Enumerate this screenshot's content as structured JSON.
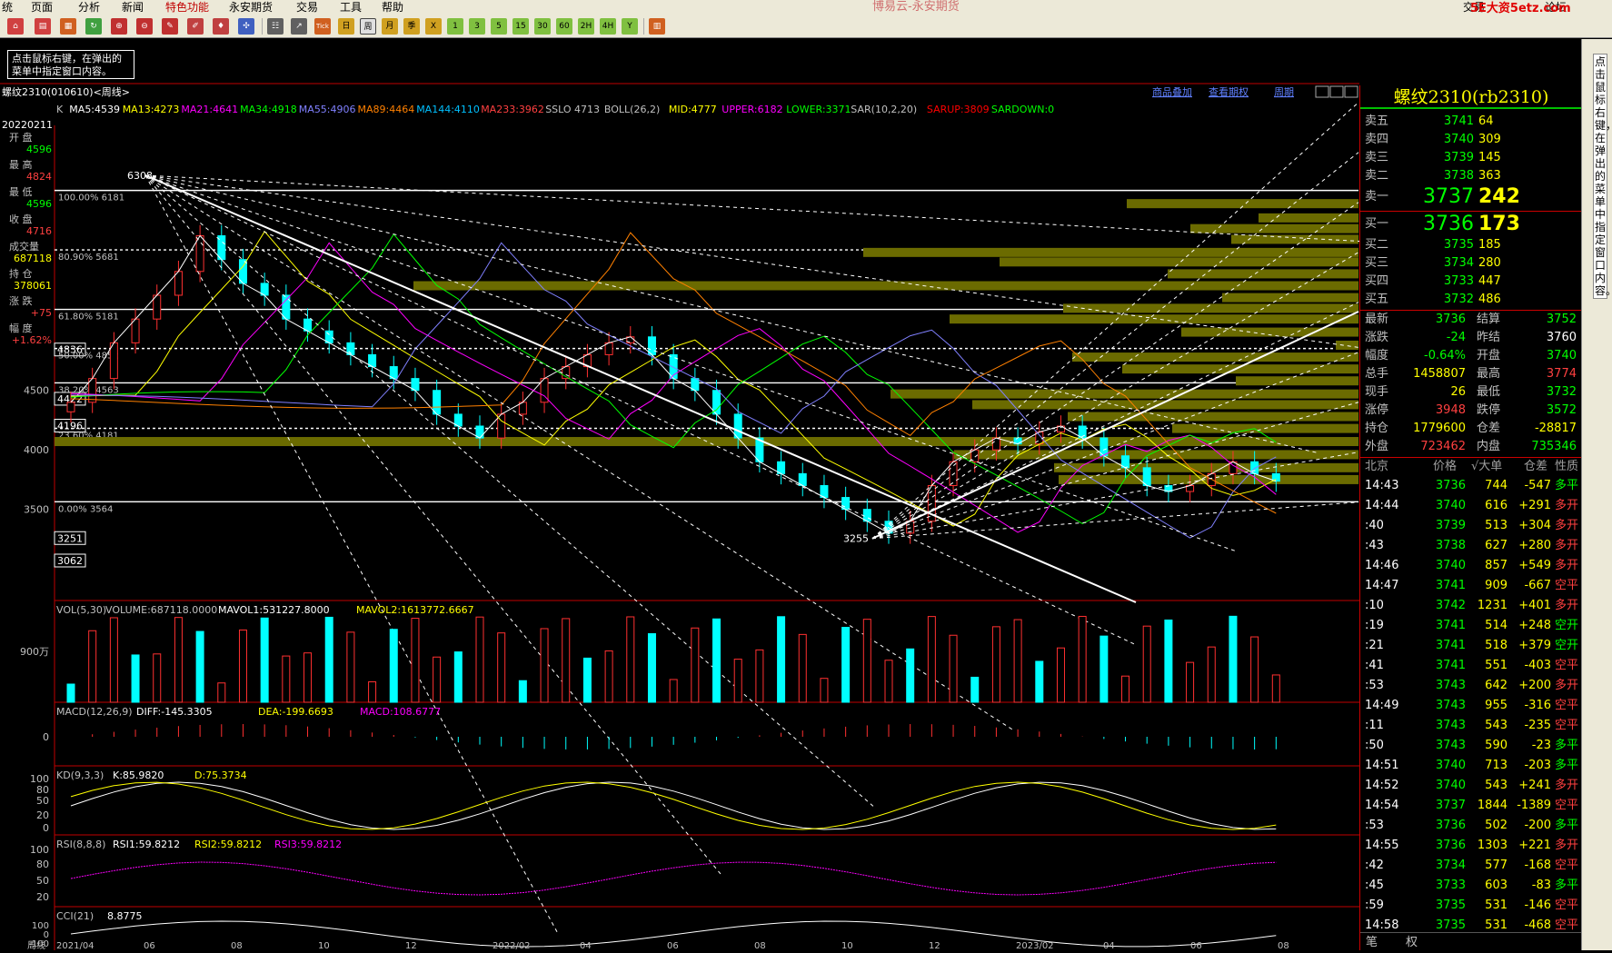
{
  "menu": {
    "items": [
      "统",
      "页面",
      "分析",
      "新闻",
      "特色功能",
      "永安期货",
      "交易",
      "工具",
      "帮助"
    ],
    "window_title": "博易云-永安期货",
    "right_buttons": [
      "交易",
      "论坛"
    ],
    "watermark": "5E大资5etz.com"
  },
  "toolbar": {
    "icons": [
      "home-icon",
      "page-icon",
      "layout-icon",
      "refresh-icon",
      "zoom-in-icon",
      "zoom-out-icon",
      "pen-icon",
      "paint-icon",
      "indicator-icon",
      "tool-icon",
      "table-icon",
      "trend-icon",
      "tick-icon",
      "period-icon",
      "week-icon",
      "month-icon",
      "quarter-icon",
      "x-icon",
      "1-icon",
      "3-icon",
      "5-icon",
      "15-icon",
      "30-icon",
      "60-icon",
      "2h-icon",
      "4h-icon",
      "y-icon",
      "calc-icon"
    ],
    "labels": {
      "tick": "Tick",
      "day": "日",
      "week": "周",
      "month": "月",
      "quarter": "季",
      "x": "X",
      "m1": "1",
      "m3": "3",
      "m5": "5",
      "m15": "15",
      "m30": "30",
      "m60": "60",
      "h2": "2H",
      "h4": "4H",
      "y": "Y"
    }
  },
  "hint": {
    "text": "点击鼠标右键，在弹出的菜单中指定窗口内容。"
  },
  "chart_header": {
    "symbol": "螺纹2310(010610)<周线>",
    "links": [
      "商品叠加",
      "查看期权",
      "周期"
    ]
  },
  "main_indicators": [
    {
      "text": "K",
      "color": "#c0c0c0"
    },
    {
      "text": "MA5:4539",
      "color": "#ffffff"
    },
    {
      "text": "MA13:4273",
      "color": "#ffff00"
    },
    {
      "text": "MA21:4641",
      "color": "#ff00ff"
    },
    {
      "text": "MA34:4918",
      "color": "#00ff00"
    },
    {
      "text": "MA55:4906",
      "color": "#8080ff"
    },
    {
      "text": "MA89:4464",
      "color": "#ff8000"
    },
    {
      "text": "MA144:4110",
      "color": "#00c0ff"
    },
    {
      "text": "MA233:3962",
      "color": "#ff4040"
    },
    {
      "text": "SSLO 4713",
      "color": "#c0c0c0"
    },
    {
      "text": "BOLL(26,2)",
      "color": "#c0c0c0"
    },
    {
      "text": "MID:4777",
      "color": "#ffff00"
    },
    {
      "text": "UPPER:6182",
      "color": "#ff00ff"
    },
    {
      "text": "LOWER:3371",
      "color": "#00ff00"
    },
    {
      "text": "SAR(10,2,20)",
      "color": "#c0c0c0"
    },
    {
      "text": "SARUP:3809",
      "color": "#ff0000"
    },
    {
      "text": "SARDOWN:0",
      "color": "#00ff00"
    }
  ],
  "left_info": {
    "date": "20220211",
    "rows": [
      {
        "label": "开 盘",
        "value": "4596",
        "color": "#00ff00"
      },
      {
        "label": "最 高",
        "value": "4824",
        "color": "#ff4040"
      },
      {
        "label": "最 低",
        "value": "4596",
        "color": "#00ff00"
      },
      {
        "label": "收 盘",
        "value": "4716",
        "color": "#ff4040"
      },
      {
        "label": "成交量",
        "value": "687118",
        "color": "#ffff00"
      },
      {
        "label": "持 仓",
        "value": "378061",
        "color": "#ffff00"
      },
      {
        "label": "涨 跌",
        "value": "+75",
        "color": "#ff4040"
      },
      {
        "label": "幅 度",
        "value": "+1.62%",
        "color": "#ff4040"
      }
    ]
  },
  "price_axis": {
    "ticks": [
      "4500",
      "4000",
      "3500"
    ],
    "boxes": [
      "4836",
      "4422",
      "4196",
      "3251",
      "3062"
    ]
  },
  "fib_labels": [
    "100.00% 6181",
    "80.90% 5681",
    "61.80% 5181",
    "50.00% 4852",
    "38.20% 4563",
    "23.60% 4181",
    "0.00% 3564"
  ],
  "price_marks": {
    "high": "6308",
    "low": "3255"
  },
  "vol_panel": {
    "header": [
      "VOL(5,30)",
      "VOLUME:687118.0000",
      "MAVOL1:531227.8000",
      "MAVOL2:1613772.6667"
    ],
    "axis": "900万"
  },
  "macd_panel": {
    "header": [
      "MACD(12,26,9)",
      "DIFF:-145.3305",
      "DEA:-199.6693",
      "MACD:108.6777"
    ],
    "axis": "0"
  },
  "kd_panel": {
    "header": [
      "KD(9,3,3)",
      "K:85.9820",
      "D:75.3734"
    ],
    "axis": [
      "100",
      "80",
      "50",
      "20",
      "0"
    ]
  },
  "rsi_panel": {
    "header": [
      "RSI(8,8,8)",
      "RSI1:59.8212",
      "RSI2:59.8212",
      "RSI3:59.8212"
    ],
    "axis": [
      "100",
      "80",
      "50",
      "20"
    ]
  },
  "cci_panel": {
    "header": [
      "CCI(21)",
      "8.8775"
    ],
    "axis": [
      "100",
      "0",
      "-100"
    ]
  },
  "date_axis": {
    "labels": [
      "周线",
      "2021/04",
      "06",
      "08",
      "10",
      "12",
      "2022/02",
      "04",
      "06",
      "08",
      "10",
      "12",
      "2023/02",
      "04",
      "06",
      "08"
    ]
  },
  "quote": {
    "title": "螺纹2310(rb2310)",
    "asks": [
      {
        "label": "卖五",
        "price": "3741",
        "vol": "64"
      },
      {
        "label": "卖四",
        "price": "3740",
        "vol": "309"
      },
      {
        "label": "卖三",
        "price": "3739",
        "vol": "145"
      },
      {
        "label": "卖二",
        "price": "3738",
        "vol": "363"
      },
      {
        "label": "卖一",
        "price": "3737",
        "vol": "242"
      }
    ],
    "bids": [
      {
        "label": "买一",
        "price": "3736",
        "vol": "173"
      },
      {
        "label": "买二",
        "price": "3735",
        "vol": "185"
      },
      {
        "label": "买三",
        "price": "3734",
        "vol": "280"
      },
      {
        "label": "买四",
        "price": "3733",
        "vol": "447"
      },
      {
        "label": "买五",
        "price": "3732",
        "vol": "486"
      }
    ],
    "stats": [
      {
        "l1": "最新",
        "v1": "3736",
        "c1": "#00ff00",
        "l2": "结算",
        "v2": "3752",
        "c2": "#00ff00"
      },
      {
        "l1": "涨跌",
        "v1": "-24",
        "c1": "#00ff00",
        "l2": "昨结",
        "v2": "3760",
        "c2": "#ffffff"
      },
      {
        "l1": "幅度",
        "v1": "-0.64%",
        "c1": "#00ff00",
        "l2": "开盘",
        "v2": "3740",
        "c2": "#00ff00"
      },
      {
        "l1": "总手",
        "v1": "1458807",
        "c1": "#ffff00",
        "l2": "最高",
        "v2": "3774",
        "c2": "#ff4040"
      },
      {
        "l1": "现手",
        "v1": "26",
        "c1": "#ffff00",
        "l2": "最低",
        "v2": "3732",
        "c2": "#00ff00"
      },
      {
        "l1": "涨停",
        "v1": "3948",
        "c1": "#ff4040",
        "l2": "跌停",
        "v2": "3572",
        "c2": "#00ff00"
      },
      {
        "l1": "持仓",
        "v1": "1779600",
        "c1": "#ffff00",
        "l2": "仓差",
        "v2": "-28817",
        "c2": "#ffff00"
      },
      {
        "l1": "外盘",
        "v1": "723462",
        "c1": "#ff4040",
        "l2": "内盘",
        "v2": "735346",
        "c2": "#00ff00"
      }
    ],
    "tick_header": [
      "北京",
      "价格",
      "√大单",
      "仓差",
      "性质"
    ],
    "ticks": [
      {
        "t": "14:43",
        "p": "3736",
        "v": "744",
        "d": "-547",
        "n": "多平",
        "nc": "#00ff00"
      },
      {
        "t": "14:44",
        "p": "3740",
        "v": "616",
        "d": "+291",
        "n": "多开",
        "nc": "#ff4040"
      },
      {
        "t": ":40",
        "p": "3739",
        "v": "513",
        "d": "+304",
        "n": "多开",
        "nc": "#ff4040"
      },
      {
        "t": ":43",
        "p": "3738",
        "v": "627",
        "d": "+280",
        "n": "多开",
        "nc": "#ff4040"
      },
      {
        "t": "14:46",
        "p": "3740",
        "v": "857",
        "d": "+549",
        "n": "多开",
        "nc": "#ff4040"
      },
      {
        "t": "14:47",
        "p": "3741",
        "v": "909",
        "d": "-667",
        "n": "空平",
        "nc": "#ff4040"
      },
      {
        "t": ":10",
        "p": "3742",
        "v": "1231",
        "d": "+401",
        "n": "多开",
        "nc": "#ff4040"
      },
      {
        "t": ":19",
        "p": "3741",
        "v": "514",
        "d": "+248",
        "n": "空开",
        "nc": "#00ff00"
      },
      {
        "t": ":21",
        "p": "3741",
        "v": "518",
        "d": "+379",
        "n": "空开",
        "nc": "#00ff00"
      },
      {
        "t": ":41",
        "p": "3741",
        "v": "551",
        "d": "-403",
        "n": "空平",
        "nc": "#ff4040"
      },
      {
        "t": ":53",
        "p": "3743",
        "v": "642",
        "d": "+200",
        "n": "多开",
        "nc": "#ff4040"
      },
      {
        "t": "14:49",
        "p": "3743",
        "v": "955",
        "d": "-316",
        "n": "空平",
        "nc": "#ff4040"
      },
      {
        "t": ":11",
        "p": "3743",
        "v": "543",
        "d": "-235",
        "n": "空平",
        "nc": "#ff4040"
      },
      {
        "t": ":50",
        "p": "3743",
        "v": "590",
        "d": "-23",
        "n": "多平",
        "nc": "#00ff00"
      },
      {
        "t": "14:51",
        "p": "3740",
        "v": "713",
        "d": "-203",
        "n": "多平",
        "nc": "#00ff00"
      },
      {
        "t": "14:52",
        "p": "3740",
        "v": "543",
        "d": "+241",
        "n": "多开",
        "nc": "#ff4040"
      },
      {
        "t": "14:54",
        "p": "3737",
        "v": "1844",
        "d": "-1389",
        "n": "空平",
        "nc": "#ff4040"
      },
      {
        "t": ":53",
        "p": "3736",
        "v": "502",
        "d": "-200",
        "n": "多平",
        "nc": "#00ff00"
      },
      {
        "t": "14:55",
        "p": "3736",
        "v": "1303",
        "d": "+221",
        "n": "多开",
        "nc": "#ff4040"
      },
      {
        "t": ":42",
        "p": "3734",
        "v": "577",
        "d": "-168",
        "n": "空平",
        "nc": "#ff4040"
      },
      {
        "t": ":45",
        "p": "3733",
        "v": "603",
        "d": "-83",
        "n": "多平",
        "nc": "#00ff00"
      },
      {
        "t": ":59",
        "p": "3735",
        "v": "531",
        "d": "-146",
        "n": "空平",
        "nc": "#ff4040"
      },
      {
        "t": "14:58",
        "p": "3735",
        "v": "531",
        "d": "-468",
        "n": "空平",
        "nc": "#ff4040"
      }
    ],
    "footer": [
      "笔",
      "权"
    ]
  },
  "sidebar_text": "点击鼠标右键，在弹出的菜单中指定窗口内容。",
  "chart_data": {
    "type": "candlestick",
    "price_range": [
      3062,
      6308
    ],
    "weekly_close_approx": [
      4400,
      4600,
      4900,
      5100,
      5300,
      5500,
      5800,
      5600,
      5400,
      5300,
      5100,
      5000,
      4900,
      4800,
      4700,
      4600,
      4500,
      4300,
      4200,
      4100,
      4300,
      4400,
      4600,
      4700,
      4800,
      4900,
      4950,
      4800,
      4600,
      4500,
      4300,
      4100,
      3900,
      3800,
      3700,
      3600,
      3500,
      3400,
      3300,
      3400,
      3700,
      3900,
      4000,
      4100,
      4050,
      4150,
      4200,
      4100,
      3950,
      3850,
      3700,
      3650,
      3700,
      3800,
      3900,
      3800,
      3737
    ]
  }
}
